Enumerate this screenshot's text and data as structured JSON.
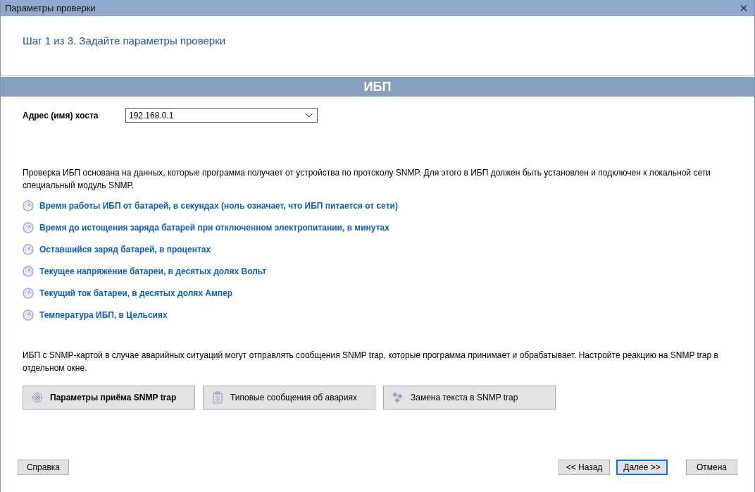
{
  "window": {
    "title": "Параметры проверки",
    "close": "✕"
  },
  "step": "Шаг 1 из 3. Задайте параметры проверки",
  "section": "ИБП",
  "host": {
    "label": "Адрес (имя) хоста",
    "value": "192.168.0.1"
  },
  "description": "Проверка ИБП основана на данных, которые программа получает от устройства по протоколу SNMP. Для этого в ИБП должен быть установлен и подключен к локальной сети специальный модуль SNMP.",
  "parameters": [
    {
      "label": "Время работы ИБП от батарей, в секундах (ноль означает, что ИБП питается от сети)"
    },
    {
      "label": "Время до истощения заряда батарей при отключенном электропитании, в минутах"
    },
    {
      "label": "Оставшийся заряд батарей, в процентах"
    },
    {
      "label": "Текущее напряжение батареи, в десятых долях Вольт"
    },
    {
      "label": "Текущий ток батареи, в десятых долях Ампер"
    },
    {
      "label": "Температура ИБП, в Цельсиях"
    }
  ],
  "trap_note": "ИБП с SNMP-картой в случае аварийных ситуаций могут отправлять сообщения SNMP trap, которые программа принимает и обрабатывает. Настройте реакцию на SNMP trap в отдельном окне.",
  "tool_buttons": [
    {
      "label": "Параметры приёма SNMP trap",
      "kind": "web",
      "bold": true
    },
    {
      "label": "Типовые сообщения об авариях",
      "kind": "clipboard",
      "bold": false
    },
    {
      "label": "Замена текста в SNMP trap",
      "kind": "gears",
      "bold": false
    }
  ],
  "footer": {
    "help": {
      "label": "Справка"
    },
    "buttons": [
      {
        "label": "<< Назад",
        "default": false
      },
      {
        "label": "Далее >>",
        "default": true
      },
      {
        "label": "Отмена",
        "default": false
      }
    ]
  }
}
